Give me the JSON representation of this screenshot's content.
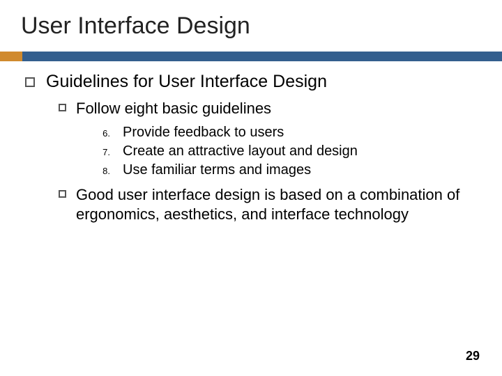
{
  "title": "User Interface Design",
  "bullets": {
    "level1": "Guidelines for User Interface Design",
    "sub1": "Follow eight basic guidelines",
    "items": [
      {
        "num": "6.",
        "text": "Provide feedback to users"
      },
      {
        "num": "7.",
        "text": "Create an attractive layout and design"
      },
      {
        "num": "8.",
        "text": "Use familiar terms and images"
      }
    ],
    "sub2": "Good user interface design is based on a combination of ergonomics, aesthetics, and interface technology"
  },
  "page_number": "29"
}
